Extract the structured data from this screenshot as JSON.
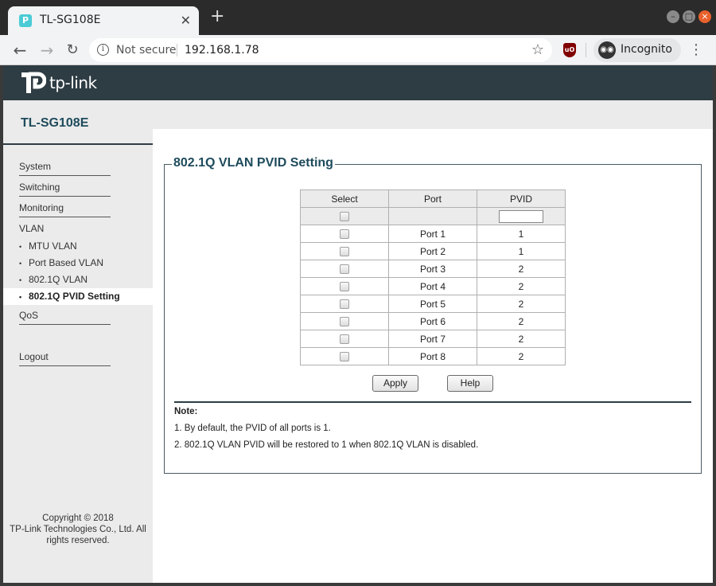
{
  "browser": {
    "tab_title": "TL-SG108E",
    "security_label": "Not secure",
    "url": "192.168.1.78",
    "incognito_label": "Incognito",
    "new_tab": "+",
    "tab_close": "✕"
  },
  "brand": {
    "logo_text": "tp-link"
  },
  "sidebar": {
    "model": "TL-SG108E",
    "items": [
      {
        "label": "System"
      },
      {
        "label": "Switching"
      },
      {
        "label": "Monitoring"
      },
      {
        "label": "VLAN"
      }
    ],
    "vlan_subitems": [
      {
        "label": "MTU VLAN"
      },
      {
        "label": "Port Based VLAN"
      },
      {
        "label": "802.1Q VLAN"
      },
      {
        "label": "802.1Q PVID Setting"
      }
    ],
    "qos": "QoS",
    "logout": "Logout",
    "copyright": [
      "Copyright © 2018",
      "TP-Link Technologies Co., Ltd. All",
      "rights reserved."
    ]
  },
  "main": {
    "title": "802.1Q VLAN PVID Setting",
    "table": {
      "headers": [
        "Select",
        "Port",
        "PVID"
      ],
      "rows": [
        {
          "port": "Port 1",
          "pvid": "1"
        },
        {
          "port": "Port 2",
          "pvid": "1"
        },
        {
          "port": "Port 3",
          "pvid": "2"
        },
        {
          "port": "Port 4",
          "pvid": "2"
        },
        {
          "port": "Port 5",
          "pvid": "2"
        },
        {
          "port": "Port 6",
          "pvid": "2"
        },
        {
          "port": "Port 7",
          "pvid": "2"
        },
        {
          "port": "Port 8",
          "pvid": "2"
        }
      ],
      "pvid_input_value": ""
    },
    "apply_label": "Apply",
    "help_label": "Help",
    "note_title": "Note:",
    "notes": [
      "1. By default, the PVID of all ports is 1.",
      "2. 802.1Q VLAN PVID will be restored to 1 when 802.1Q VLAN is disabled."
    ]
  }
}
